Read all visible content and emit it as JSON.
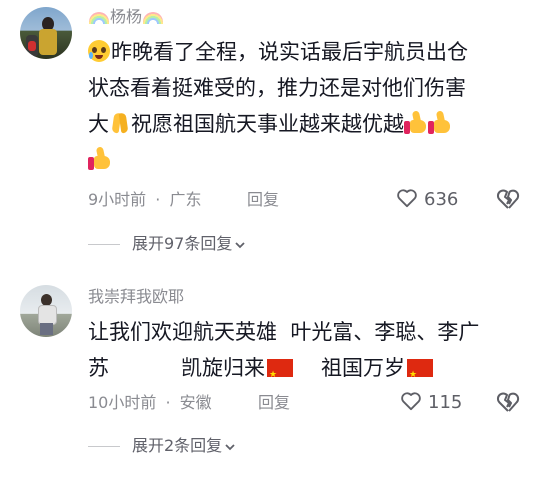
{
  "comments": [
    {
      "username": "杨杨",
      "text_lines": [
        "昨晚看了全程，说实话最后宇航员出仓",
        "状态看着挺难受的，推力还是对他们伤害",
        "大",
        "祝愿祖国航天事业越来越优越"
      ],
      "time": "9小时前",
      "location": "广东",
      "reply_label": "回复",
      "likes": "636",
      "expand_label": "展开97条回复"
    },
    {
      "username": "我崇拜我欧耶",
      "text_lines": [
        "让我们欢迎航天英雄  叶光富、李聪、李广",
        "苏",
        "凯旋归来",
        "祖国万岁"
      ],
      "time": "10小时前",
      "location": "安徽",
      "reply_label": "回复",
      "likes": "115",
      "expand_label": "展开2条回复"
    }
  ],
  "separator": "·",
  "icons": [
    "rainbow-icon",
    "crying-face-icon",
    "folded-hands-icon",
    "thumbs-up-icon",
    "china-flag-icon",
    "heart-icon",
    "broken-heart-icon",
    "chevron-down-icon"
  ],
  "colors": {
    "secondary_text": "#8a8b91",
    "primary_text": "#161823"
  }
}
